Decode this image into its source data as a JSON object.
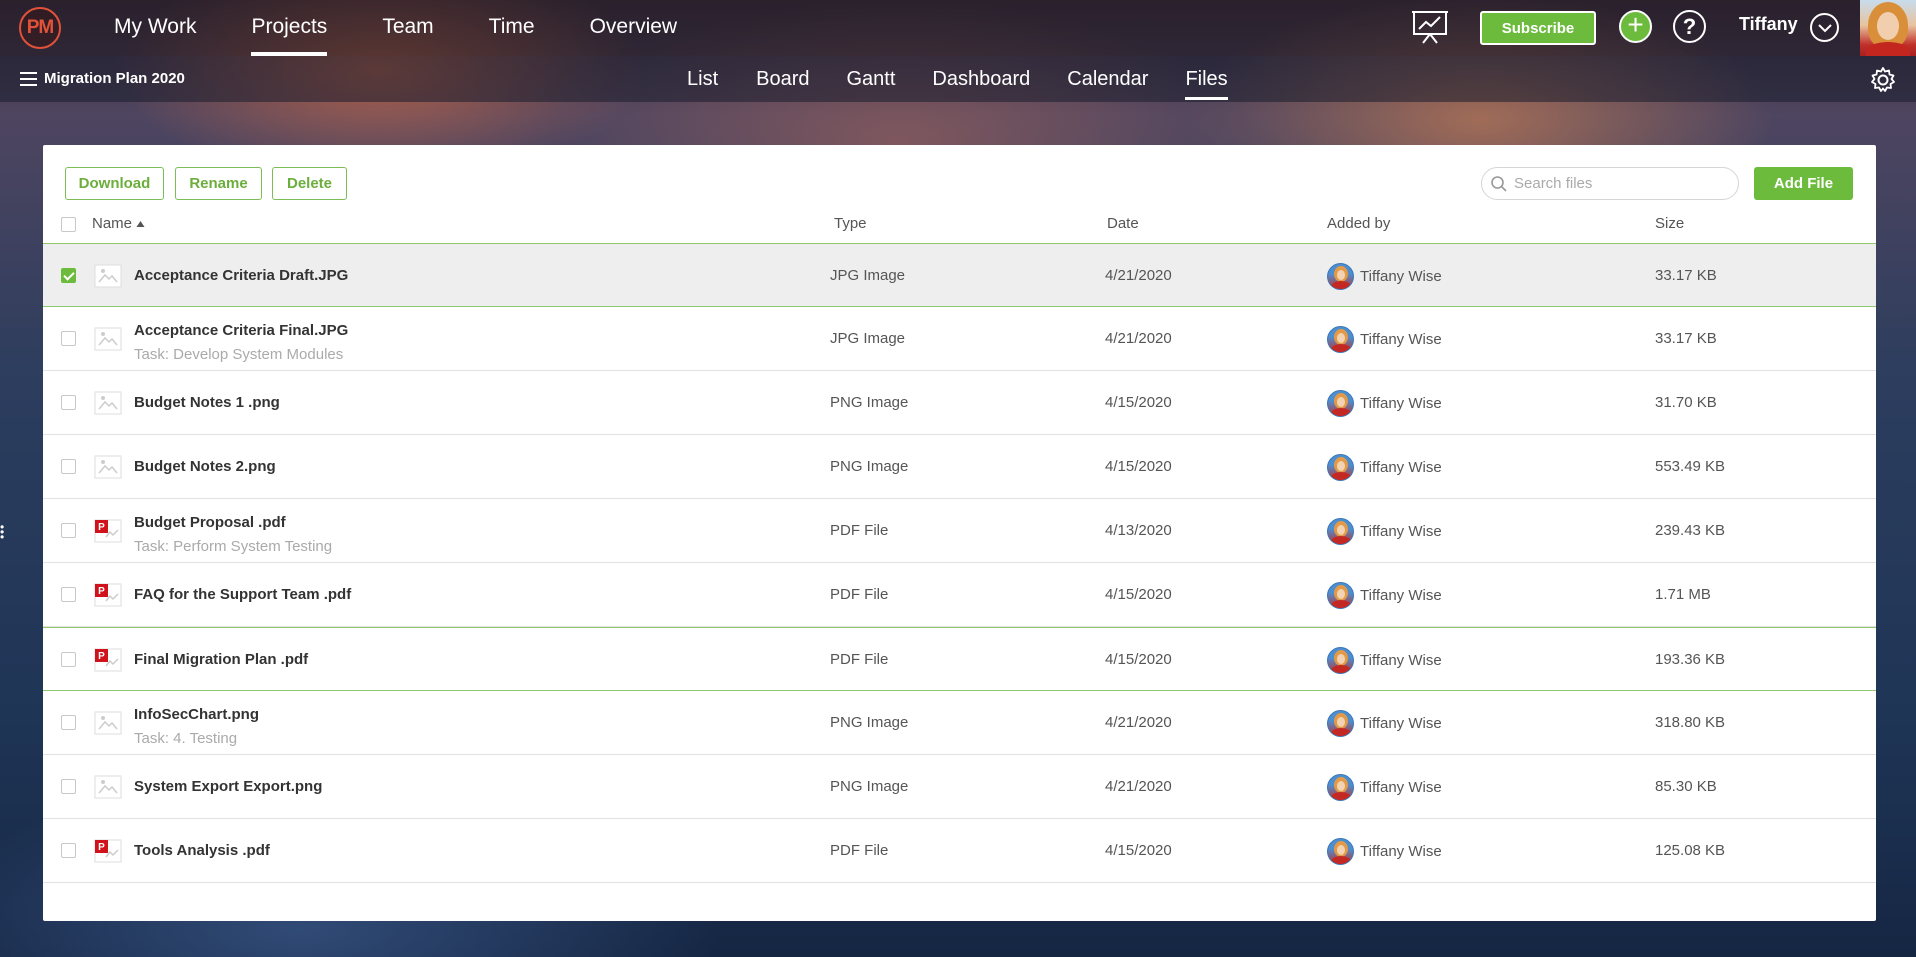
{
  "header": {
    "logo_text": "PM",
    "nav": [
      {
        "label": "My Work",
        "active": false
      },
      {
        "label": "Projects",
        "active": true
      },
      {
        "label": "Team",
        "active": false
      },
      {
        "label": "Time",
        "active": false
      },
      {
        "label": "Overview",
        "active": false
      }
    ],
    "subscribe_label": "Subscribe",
    "plus_label": "+",
    "help_label": "?",
    "user_name": "Tiffany"
  },
  "subbar": {
    "project_name": "Migration Plan 2020",
    "tabs": [
      {
        "label": "List",
        "active": false
      },
      {
        "label": "Board",
        "active": false
      },
      {
        "label": "Gantt",
        "active": false
      },
      {
        "label": "Dashboard",
        "active": false
      },
      {
        "label": "Calendar",
        "active": false
      },
      {
        "label": "Files",
        "active": true
      }
    ]
  },
  "toolbar": {
    "download_label": "Download",
    "rename_label": "Rename",
    "delete_label": "Delete",
    "search_placeholder": "Search files",
    "add_file_label": "Add File"
  },
  "columns": {
    "name": "Name",
    "type": "Type",
    "date": "Date",
    "added_by": "Added by",
    "size": "Size"
  },
  "files": [
    {
      "name": "Acceptance Criteria Draft.JPG",
      "task": "",
      "type": "JPG Image",
      "date": "4/21/2020",
      "added_by": "Tiffany Wise",
      "size": "33.17 KB",
      "icon": "image-file-icon",
      "checked": true
    },
    {
      "name": "Acceptance Criteria Final.JPG",
      "task": "Task: Develop System Modules",
      "type": "JPG Image",
      "date": "4/21/2020",
      "added_by": "Tiffany Wise",
      "size": "33.17 KB",
      "icon": "image-file-icon",
      "checked": false
    },
    {
      "name": "Budget Notes 1 .png",
      "task": "",
      "type": "PNG Image",
      "date": "4/15/2020",
      "added_by": "Tiffany Wise",
      "size": "31.70 KB",
      "icon": "image-file-icon",
      "checked": false
    },
    {
      "name": "Budget Notes 2.png",
      "task": "",
      "type": "PNG Image",
      "date": "4/15/2020",
      "added_by": "Tiffany Wise",
      "size": "553.49 KB",
      "icon": "image-file-icon",
      "checked": false
    },
    {
      "name": "Budget Proposal .pdf",
      "task": "Task: Perform System Testing",
      "type": "PDF File",
      "date": "4/13/2020",
      "added_by": "Tiffany Wise",
      "size": "239.43 KB",
      "icon": "pdf-file-icon",
      "checked": false
    },
    {
      "name": "FAQ for the Support Team .pdf",
      "task": "",
      "type": "PDF File",
      "date": "4/15/2020",
      "added_by": "Tiffany Wise",
      "size": "1.71 MB",
      "icon": "pdf-file-icon",
      "checked": false
    },
    {
      "name": "Final Migration Plan .pdf",
      "task": "",
      "type": "PDF File",
      "date": "4/15/2020",
      "added_by": "Tiffany Wise",
      "size": "193.36 KB",
      "icon": "pdf-file-icon",
      "checked": false
    },
    {
      "name": "InfoSecChart.png",
      "task": "Task: 4. Testing",
      "type": "PNG Image",
      "date": "4/21/2020",
      "added_by": "Tiffany Wise",
      "size": "318.80 KB",
      "icon": "image-file-icon",
      "checked": false
    },
    {
      "name": "System Export Export.png",
      "task": "",
      "type": "PNG Image",
      "date": "4/21/2020",
      "added_by": "Tiffany Wise",
      "size": "85.30 KB",
      "icon": "image-file-icon",
      "checked": false
    },
    {
      "name": "Tools Analysis .pdf",
      "task": "",
      "type": "PDF File",
      "date": "4/15/2020",
      "added_by": "Tiffany Wise",
      "size": "125.08 KB",
      "icon": "pdf-file-icon",
      "checked": false
    }
  ],
  "colors": {
    "accent_green": "#6cbb3c",
    "pdf_red": "#d0121b",
    "logo_red": "#e0533a"
  }
}
